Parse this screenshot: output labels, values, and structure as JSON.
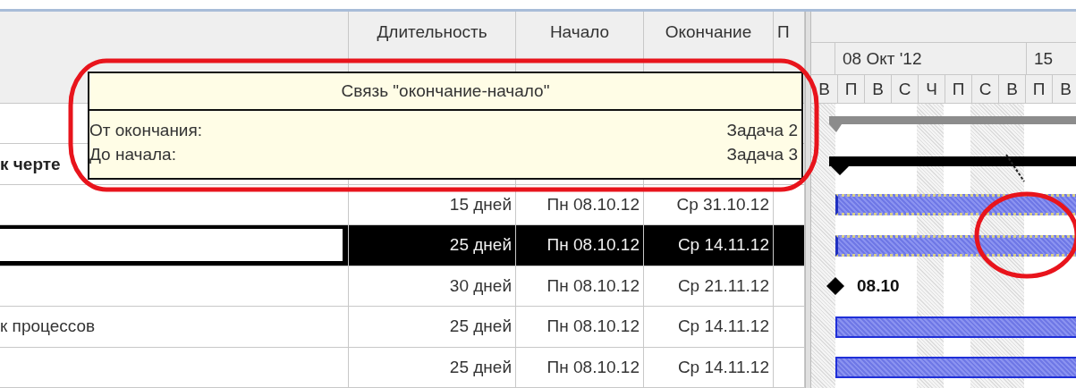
{
  "header": {
    "duration": "Длительность",
    "start": "Начало",
    "finish": "Окончание",
    "column_5": "П"
  },
  "timescale": {
    "weeks": [
      "08 Окт '12",
      "15"
    ],
    "days": [
      "В",
      "П",
      "В",
      "С",
      "Ч",
      "П",
      "С",
      "В",
      "П",
      "В"
    ]
  },
  "rows": [
    {
      "kind": "summary-gray",
      "selected": false
    },
    {
      "kind": "summary",
      "name": "к черте",
      "selected": false
    },
    {
      "kind": "task",
      "duration": "15 дней",
      "start": "Пн 08.10.12",
      "finish": "Ср 31.10.12",
      "selected": false
    },
    {
      "kind": "task",
      "duration": "25 дней",
      "start": "Пн 08.10.12",
      "finish": "Ср 14.11.12",
      "selected": true
    },
    {
      "kind": "milestone",
      "duration": "30 дней",
      "start": "Пн 08.10.12",
      "finish": "Ср 21.11.12",
      "bar_label": "08.10",
      "selected": false
    },
    {
      "kind": "task-plain",
      "name": "к процессов",
      "duration": "25 дней",
      "start": "Пн 08.10.12",
      "finish": "Ср 14.11.12",
      "selected": false
    },
    {
      "kind": "task-plain",
      "duration": "25 дней",
      "start": "Пн 08.10.12",
      "finish": "Ср 14.11.12",
      "selected": false
    }
  ],
  "tooltip": {
    "title": "Связь \"окончание-начало\"",
    "rows": [
      {
        "label": "От окончания:",
        "value": "Задача 2"
      },
      {
        "label": "До начала:",
        "value": "Задача 3"
      }
    ]
  }
}
